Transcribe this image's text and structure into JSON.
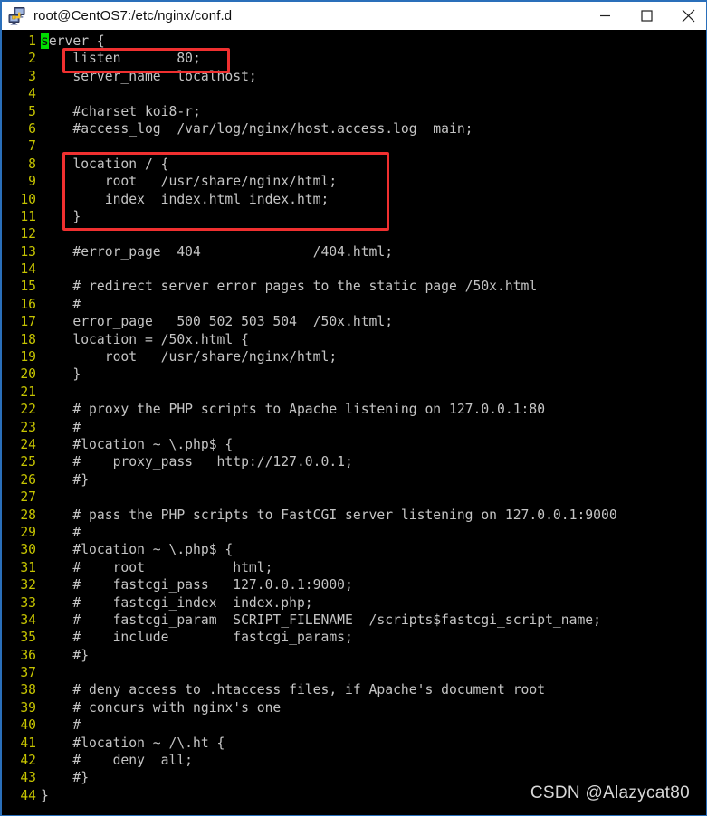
{
  "window": {
    "title": "root@CentOS7:/etc/nginx/conf.d",
    "icon": "putty-icon",
    "controls": {
      "minimize_label": "Minimize",
      "maximize_label": "Maximize",
      "close_label": "Close"
    }
  },
  "terminal": {
    "background_color": "#000000",
    "text_color": "#c4c4c4",
    "lineno_color": "#c6c400",
    "cursor_color": "#00dd00",
    "cursor_line": 1,
    "cursor_char": "s",
    "total_lines": 44,
    "lines": [
      {
        "n": "1",
        "text": "server {",
        "cursor": true,
        "head": "s",
        "rest": "erver {"
      },
      {
        "n": "2",
        "text": "    listen       80;"
      },
      {
        "n": "3",
        "text": "    server_name  localhost;"
      },
      {
        "n": "4",
        "text": ""
      },
      {
        "n": "5",
        "text": "    #charset koi8-r;"
      },
      {
        "n": "6",
        "text": "    #access_log  /var/log/nginx/host.access.log  main;"
      },
      {
        "n": "7",
        "text": ""
      },
      {
        "n": "8",
        "text": "    location / {"
      },
      {
        "n": "9",
        "text": "        root   /usr/share/nginx/html;"
      },
      {
        "n": "10",
        "text": "        index  index.html index.htm;"
      },
      {
        "n": "11",
        "text": "    }"
      },
      {
        "n": "12",
        "text": ""
      },
      {
        "n": "13",
        "text": "    #error_page  404              /404.html;"
      },
      {
        "n": "14",
        "text": ""
      },
      {
        "n": "15",
        "text": "    # redirect server error pages to the static page /50x.html"
      },
      {
        "n": "16",
        "text": "    #"
      },
      {
        "n": "17",
        "text": "    error_page   500 502 503 504  /50x.html;"
      },
      {
        "n": "18",
        "text": "    location = /50x.html {"
      },
      {
        "n": "19",
        "text": "        root   /usr/share/nginx/html;"
      },
      {
        "n": "20",
        "text": "    }"
      },
      {
        "n": "21",
        "text": ""
      },
      {
        "n": "22",
        "text": "    # proxy the PHP scripts to Apache listening on 127.0.0.1:80"
      },
      {
        "n": "23",
        "text": "    #"
      },
      {
        "n": "24",
        "text": "    #location ~ \\.php$ {"
      },
      {
        "n": "25",
        "text": "    #    proxy_pass   http://127.0.0.1;"
      },
      {
        "n": "26",
        "text": "    #}"
      },
      {
        "n": "27",
        "text": ""
      },
      {
        "n": "28",
        "text": "    # pass the PHP scripts to FastCGI server listening on 127.0.0.1:9000"
      },
      {
        "n": "29",
        "text": "    #"
      },
      {
        "n": "30",
        "text": "    #location ~ \\.php$ {"
      },
      {
        "n": "31",
        "text": "    #    root           html;"
      },
      {
        "n": "32",
        "text": "    #    fastcgi_pass   127.0.0.1:9000;"
      },
      {
        "n": "33",
        "text": "    #    fastcgi_index  index.php;"
      },
      {
        "n": "34",
        "text": "    #    fastcgi_param  SCRIPT_FILENAME  /scripts$fastcgi_script_name;"
      },
      {
        "n": "35",
        "text": "    #    include        fastcgi_params;"
      },
      {
        "n": "36",
        "text": "    #}"
      },
      {
        "n": "37",
        "text": ""
      },
      {
        "n": "38",
        "text": "    # deny access to .htaccess files, if Apache's document root"
      },
      {
        "n": "39",
        "text": "    # concurs with nginx's one"
      },
      {
        "n": "40",
        "text": "    #"
      },
      {
        "n": "41",
        "text": "    #location ~ /\\.ht {"
      },
      {
        "n": "42",
        "text": "    #    deny  all;"
      },
      {
        "n": "43",
        "text": "    #}"
      },
      {
        "n": "44",
        "text": "}"
      }
    ]
  },
  "annotations": {
    "color": "#f03030",
    "boxes": [
      {
        "id": "listen-directive-box",
        "label": "listen 80;"
      },
      {
        "id": "location-block-box",
        "label": "location / { ... }"
      }
    ]
  },
  "watermark": {
    "text": "CSDN @Alazycat80"
  }
}
